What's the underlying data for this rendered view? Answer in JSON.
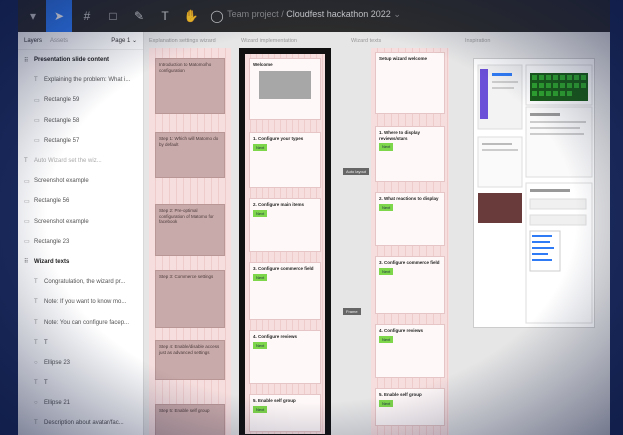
{
  "toolbar": {
    "tools": [
      "move-icon",
      "frame-icon",
      "shape-icon",
      "pen-icon",
      "text-icon",
      "hand-icon",
      "comment-icon"
    ],
    "title_team": "Team project",
    "title_sep": "/",
    "title_file": "Cloudfest hackathon 2022",
    "title_caret": "⌄"
  },
  "layers": {
    "tab_layers": "Layers",
    "tab_assets": "Assets",
    "page": "Page 1 ⌄",
    "items": [
      {
        "label": "Presentation slide content",
        "icon": "⠿",
        "bold": true,
        "indent": false
      },
      {
        "label": "Explaining the problem: What i...",
        "icon": "T",
        "indent": true
      },
      {
        "label": "Rectangle 59",
        "icon": "▭",
        "indent": true
      },
      {
        "label": "Rectangle 58",
        "icon": "▭",
        "indent": true
      },
      {
        "label": "Rectangle 57",
        "icon": "▭",
        "indent": true
      },
      {
        "label": "Auto Wizard set the wiz...",
        "icon": "T",
        "indent": false,
        "dim": true
      },
      {
        "label": "Screenshot example",
        "icon": "▭",
        "indent": false
      },
      {
        "label": "Rectangle 56",
        "icon": "▭",
        "indent": false
      },
      {
        "label": "Screenshot example",
        "icon": "▭",
        "indent": false
      },
      {
        "label": "Rectangle 23",
        "icon": "▭",
        "indent": false
      },
      {
        "label": "Wizard texts",
        "icon": "⠿",
        "bold": true,
        "indent": false
      },
      {
        "label": "Congratulation, the wizard pr...",
        "icon": "T",
        "indent": true
      },
      {
        "label": "Note: If you want to know mo...",
        "icon": "T",
        "indent": true
      },
      {
        "label": "Note: You can configure facep...",
        "icon": "T",
        "indent": true
      },
      {
        "label": "T",
        "icon": "T",
        "indent": true
      },
      {
        "label": "Ellipse 23",
        "icon": "○",
        "indent": true
      },
      {
        "label": "T",
        "icon": "T",
        "indent": true
      },
      {
        "label": "Ellipse 21",
        "icon": "○",
        "indent": true
      },
      {
        "label": "Description about avatar/fac...",
        "icon": "T",
        "indent": true
      }
    ]
  },
  "canvas": {
    "labels": {
      "explanation": "Explanation settings wizard",
      "wizard": "Wizard implementation",
      "wizard_texts": "Wizard texts",
      "inspiration": "Inspiration"
    },
    "steps": [
      "Introduction to Matomo/ho configuration",
      "Step 1: Which will Matomo do by default",
      "Step 2: Pre-optimal configuration of Matomo for facebook",
      "Step 3: Commerce settings",
      "Step 4: Enable/disable access just as advanced settings",
      "Step 5: Enable self group"
    ],
    "cards": [
      {
        "title": "Welcome",
        "chip": ""
      },
      {
        "title": "1. Configure your types",
        "chip": "Next"
      },
      {
        "title": "2. Configure main items",
        "chip": "Next"
      },
      {
        "title": "3. Configure commerce field",
        "chip": "Next"
      },
      {
        "title": "4. Configure reviews",
        "chip": "Next"
      },
      {
        "title": "5. Enable self group",
        "chip": "Next"
      }
    ],
    "text_cards": [
      {
        "title": "Setup wizard welcome",
        "chip": ""
      },
      {
        "title": "1. Where to display reviews/stars",
        "chip": "Next"
      },
      {
        "title": "2. What reactions to display",
        "chip": "Next"
      },
      {
        "title": "3. Configure commerce field",
        "chip": "Next"
      },
      {
        "title": "4. Configure reviews",
        "chip": "Next"
      },
      {
        "title": "5. Enable self group",
        "chip": "Next"
      }
    ],
    "tags": [
      "Auto layout",
      "Frame",
      "Auto layout"
    ]
  }
}
